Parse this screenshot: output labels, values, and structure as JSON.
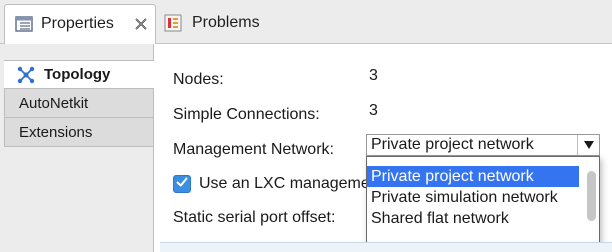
{
  "tabs": {
    "properties": {
      "label": "Properties",
      "icon": "properties-icon"
    },
    "problems": {
      "label": "Problems",
      "icon": "problems-icon"
    }
  },
  "sidebar": {
    "items": [
      {
        "label": "Topology",
        "selected": true,
        "icon": "topology-icon"
      },
      {
        "label": "AutoNetkit",
        "selected": false
      },
      {
        "label": "Extensions",
        "selected": false
      }
    ]
  },
  "main": {
    "nodes_label": "Nodes:",
    "nodes_value": "3",
    "connections_label": "Simple Connections:",
    "connections_value": "3",
    "management_label": "Management Network:",
    "management_selected": "Private project network",
    "management_options": [
      "Private project network",
      "Private simulation network",
      "Shared flat network"
    ],
    "lxc_label": "Use an LXC manageme",
    "lxc_checked": true,
    "serial_label": "Static serial port offset:"
  },
  "colors": {
    "accent": "#3574f0",
    "checkbox": "#3b8ee0",
    "chrome": "#ececec"
  }
}
